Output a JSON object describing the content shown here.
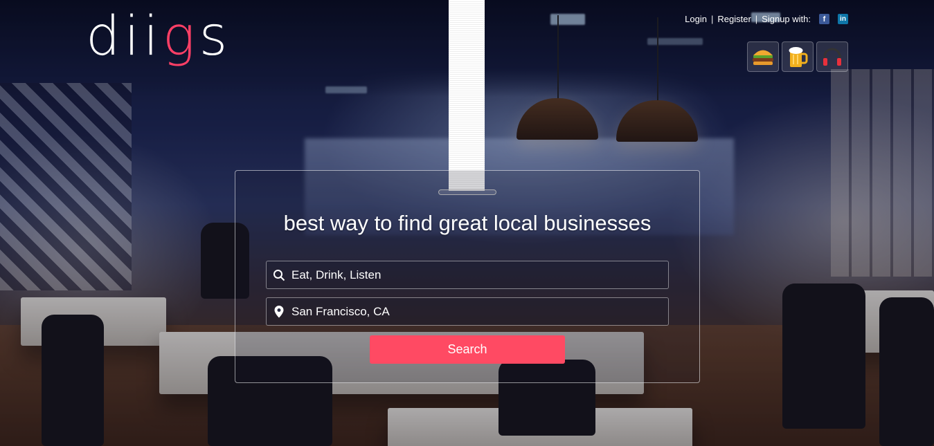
{
  "brand": {
    "logo_pre": "dii",
    "logo_accent": "g",
    "logo_post": "s",
    "accent_color": "#ff3f66"
  },
  "topnav": {
    "login": "Login",
    "register": "Register",
    "signup_label": "Signup with:",
    "separator": "|",
    "facebook_glyph": "f",
    "linkedin_glyph": "in"
  },
  "categories": [
    {
      "name": "eat",
      "icon": "burger-icon"
    },
    {
      "name": "drink",
      "icon": "beer-icon"
    },
    {
      "name": "listen",
      "icon": "headphones-icon"
    }
  ],
  "hero": {
    "headline": "best way to find great local businesses"
  },
  "search": {
    "query_value": "Eat, Drink, Listen",
    "location_value": "San Francisco, CA",
    "button_label": "Search",
    "button_color": "#ff4a63"
  }
}
